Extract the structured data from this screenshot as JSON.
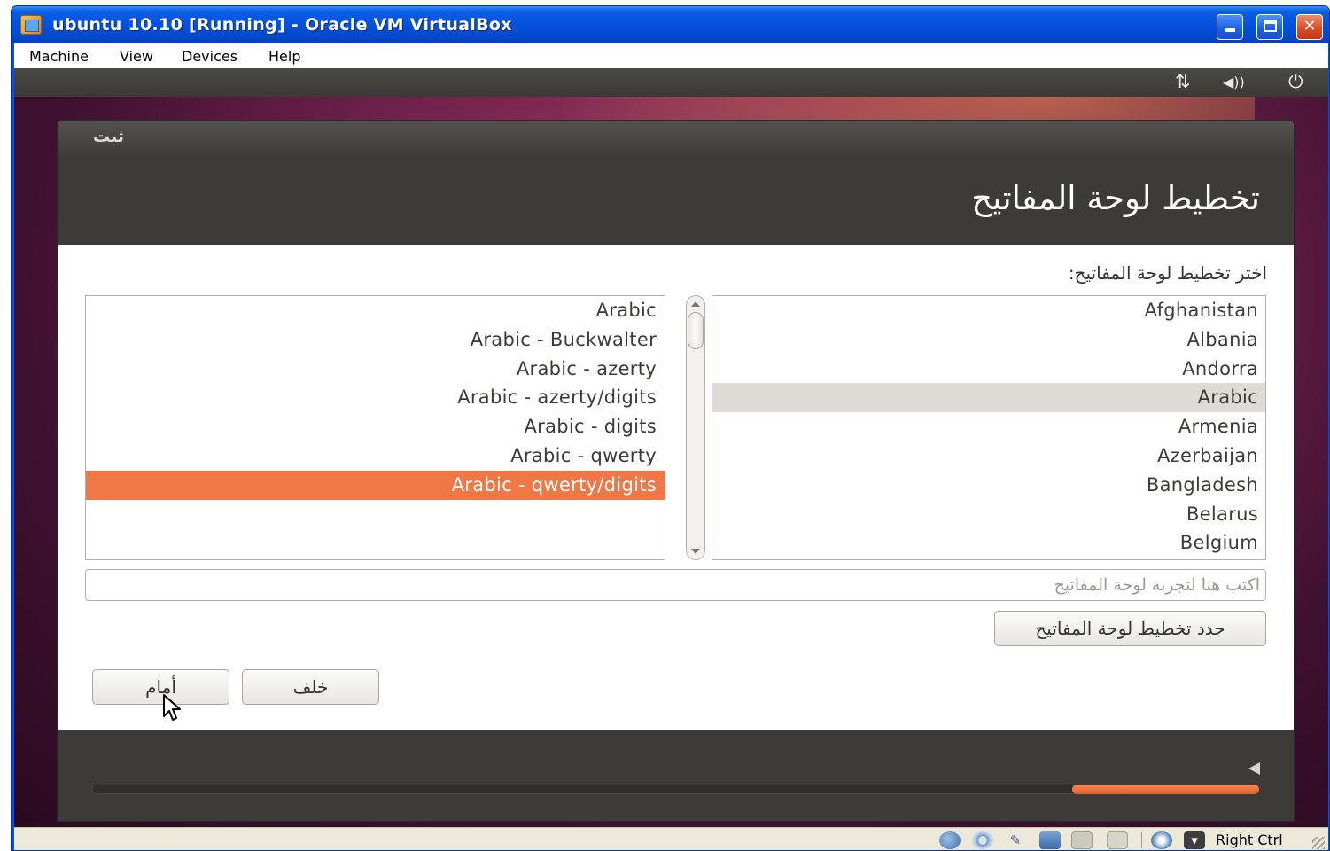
{
  "host_window": {
    "title": "ubuntu 10.10 [Running] - Oracle VM VirtualBox",
    "controls": {
      "minimize": "minimize",
      "maximize": "maximize",
      "close": "✕"
    }
  },
  "menubar": {
    "items": [
      "Machine",
      "View",
      "Devices",
      "Help"
    ]
  },
  "guest_panel": {
    "network_icon": "⇅",
    "volume_icon": "◀))",
    "power_icon": "⏻"
  },
  "installer": {
    "window_title": "ثبت",
    "page_title": "تخطيط لوحة المفاتيح",
    "prompt": "اختر تخطيط لوحة المفاتيح:",
    "variants": [
      "Arabic",
      "Arabic - Buckwalter",
      "Arabic - azerty",
      "Arabic - azerty/digits",
      "Arabic - digits",
      "Arabic - qwerty",
      "Arabic - qwerty/digits"
    ],
    "selected_variant": "Arabic - qwerty/digits",
    "countries": [
      "Afghanistan",
      "Albania",
      "Andorra",
      "Arabic",
      "Armenia",
      "Azerbaijan",
      "Bangladesh",
      "Belarus",
      "Belgium"
    ],
    "selected_country": "Arabic",
    "test_input": {
      "value": "",
      "placeholder": "اكتب هنا لتجربة لوحة المفاتيح"
    },
    "detect_button": "حدد تخطيط لوحة المفاتيح",
    "forward_button": "أمام",
    "back_button": "خلف",
    "footer_arrow_icon": "arrow-left-icon",
    "progress": 0.16,
    "accent_color": "#f07746",
    "header_color": "#3c3b37"
  },
  "statusbar": {
    "icons": [
      "hard-disk-icon",
      "cd-icon",
      "usb-icon",
      "network-icon",
      "shared-folder-icon",
      "video-capture-icon",
      "mouse-integration-icon",
      "keyboard-icon"
    ],
    "host_key": "Right Ctrl"
  }
}
